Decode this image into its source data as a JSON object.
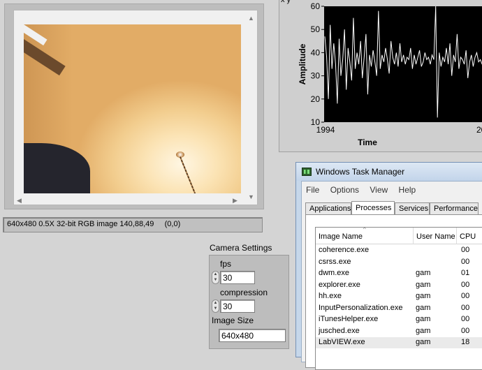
{
  "image_panel": {
    "status_text": "640x480 0.5X 32-bit RGB image 140,88,49     (0,0)"
  },
  "chart": {
    "corner_label": "x y",
    "ylabel": "Amplitude",
    "xlabel": "Time"
  },
  "chart_data": {
    "type": "line",
    "title": "",
    "xlabel": "Time",
    "ylabel": "Amplitude",
    "ylim": [
      10,
      60
    ],
    "yticks": [
      "10",
      "20",
      "30",
      "40",
      "50",
      "60"
    ],
    "xticks": [
      "1994",
      "20"
    ],
    "grid": false,
    "series": [
      {
        "values": [
          47,
          38,
          20,
          52,
          33,
          44,
          35,
          18,
          46,
          30,
          37,
          50,
          24,
          42,
          36,
          28,
          55,
          33,
          40,
          35,
          45,
          29,
          38,
          48,
          22,
          39,
          34,
          41,
          36,
          30,
          58,
          33,
          39,
          36,
          42,
          37,
          31,
          45,
          38,
          35,
          40,
          34,
          44,
          36,
          39,
          35,
          38,
          37,
          42,
          33,
          39,
          35,
          38,
          41,
          34,
          36,
          40,
          37,
          38,
          35,
          39,
          37,
          60,
          12,
          40,
          34,
          38,
          36,
          42,
          35,
          44,
          30,
          39,
          36,
          48,
          33,
          38,
          37,
          35,
          41,
          29,
          36,
          39,
          34,
          38,
          40,
          36,
          37,
          35,
          38,
          36,
          39,
          37,
          36
        ]
      }
    ]
  },
  "camera_settings": {
    "title": "Camera Settings",
    "fps_label": "fps",
    "fps_value": "30",
    "compression_label": "compression",
    "compression_value": "30",
    "image_size_label": "Image Size",
    "image_size_value": "640x480"
  },
  "task_manager": {
    "title": "Windows Task Manager",
    "menu": [
      "File",
      "Options",
      "View",
      "Help"
    ],
    "tabs": [
      "Applications",
      "Processes",
      "Services",
      "Performance"
    ],
    "active_tab": "Processes",
    "columns": [
      "Image Name",
      "User Name",
      "CPU"
    ],
    "rows": [
      {
        "name": "coherence.exe",
        "user": "",
        "cpu": "00"
      },
      {
        "name": "csrss.exe",
        "user": "",
        "cpu": "00"
      },
      {
        "name": "dwm.exe",
        "user": "gam",
        "cpu": "01"
      },
      {
        "name": "explorer.exe",
        "user": "gam",
        "cpu": "00"
      },
      {
        "name": "hh.exe",
        "user": "gam",
        "cpu": "00"
      },
      {
        "name": "InputPersonalization.exe",
        "user": "gam",
        "cpu": "00"
      },
      {
        "name": "iTunesHelper.exe",
        "user": "gam",
        "cpu": "00"
      },
      {
        "name": "jusched.exe",
        "user": "gam",
        "cpu": "00"
      },
      {
        "name": "LabVIEW.exe",
        "user": "gam",
        "cpu": "18"
      }
    ],
    "selected_row": "LabVIEW.exe"
  },
  "colors": {
    "plot_bg": "#000000",
    "trace": "#ffffff",
    "panel_bg": "#d4d4d4",
    "taskmgr_frame": "#c6d7ea"
  },
  "icons": {
    "task_manager": "taskmgr-icon",
    "sort": "sort-ascending-icon"
  }
}
